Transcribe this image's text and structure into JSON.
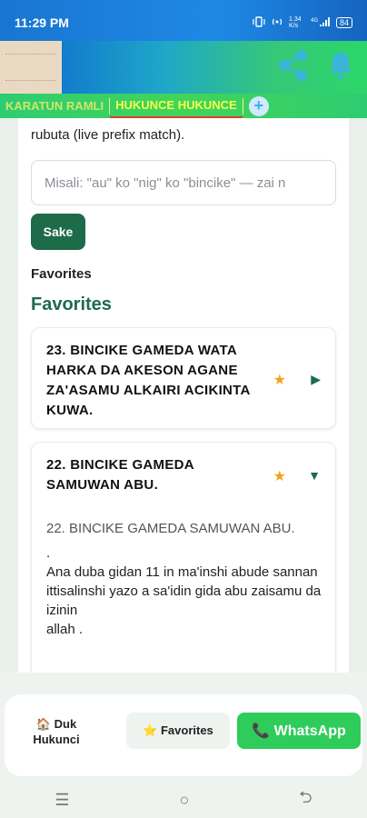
{
  "status": {
    "time": "11:29 PM",
    "icons": [
      "vibrate-icon",
      "hotspot-icon",
      "data-speed-icon",
      "signal-4g-icon",
      "battery-icon"
    ],
    "speed": "1.34 K/s",
    "network": "4G",
    "battery": "84"
  },
  "header": {
    "share_icon": "share-icon",
    "bell_icon": "bell-icon"
  },
  "tabs": [
    {
      "label": "KARATUN RAMLI"
    },
    {
      "label": "HUKUNCE HUKUNCE"
    }
  ],
  "content": {
    "help_text": "rubuta (live prefix match).",
    "search_placeholder": "Misali: \"au\" ko \"nig\" ko \"bincike\" — zai n",
    "search_button": "Sake",
    "favorites_small": "Favorites",
    "favorites_large": "Favorites",
    "cards": [
      {
        "title": "23. BINCIKE GAMEDA WATA HARKA DA AKESON AGANE ZA'ASAMU ALKAIRI ACIKINTA KUWA.",
        "star": "★",
        "toggle": "▶"
      },
      {
        "title": "22. BINCIKE GAMEDA SAMUWAN ABU.",
        "star": "★",
        "toggle": "▼",
        "body_first": "22. BINCIKE GAMEDA SAMUWAN ABU.",
        "body_lines": [
          ".",
          "Ana duba gidan 11 in ma'inshi abude sannan",
          "ittisalinshi yazo a sa'idin gida abu zaisamu da izinin",
          "allah ."
        ]
      }
    ]
  },
  "bottom_nav": {
    "home_label": "🏠 Duk Hukunci",
    "favorites_label": "⭐ Favorites",
    "whatsapp_label": "📞 WhatsApp"
  },
  "system_nav": {
    "menu": "☰",
    "home": "○",
    "back": "⮌"
  },
  "colors": {
    "accent_dark_green": "#1e6b4a",
    "whatsapp_green": "#2ecc5a",
    "tab_active": "#f5ff4a",
    "star": "#f2a21a"
  }
}
